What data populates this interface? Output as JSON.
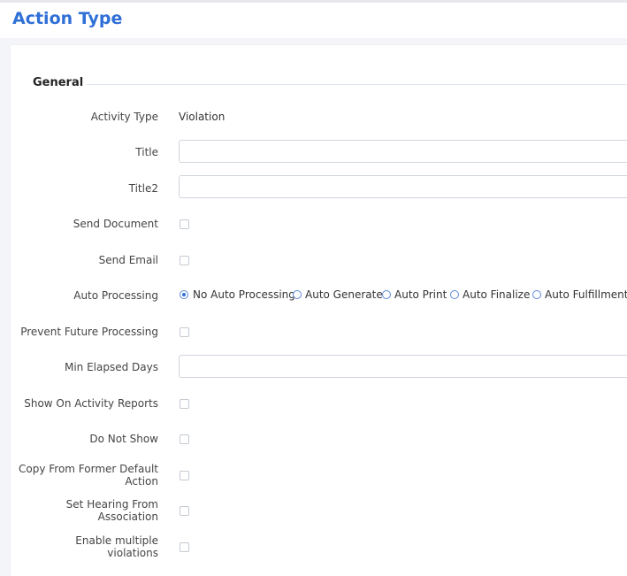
{
  "header": {
    "title": "Action Type"
  },
  "section": {
    "title": "General"
  },
  "fields": {
    "activity_type": {
      "label": "Activity Type",
      "value": "Violation"
    },
    "title": {
      "label": "Title",
      "value": ""
    },
    "title2": {
      "label": "Title2",
      "value": ""
    },
    "send_document": {
      "label": "Send Document",
      "checked": false
    },
    "send_email": {
      "label": "Send Email",
      "checked": false
    },
    "auto_processing": {
      "label": "Auto Processing",
      "options": [
        "No Auto Processing",
        "Auto Generate",
        "Auto Print",
        "Auto Finalize",
        "Auto Fulfillment"
      ],
      "selected": "No Auto Processing"
    },
    "prevent_future_processing": {
      "label": "Prevent Future Processing",
      "checked": false
    },
    "min_elapsed_days": {
      "label": "Min Elapsed Days",
      "value": ""
    },
    "show_on_activity_reports": {
      "label": "Show On Activity Reports",
      "checked": false
    },
    "do_not_show": {
      "label": "Do Not Show",
      "checked": false
    },
    "copy_from_former_default_action": {
      "label_line1": "Copy From Former Default",
      "label_line2": "Action",
      "checked": false
    },
    "set_hearing_from_association": {
      "label_line1": "Set Hearing From",
      "label_line2": "Association",
      "checked": false
    },
    "enable_multiple_violations": {
      "label_line1": "Enable multiple",
      "label_line2": "violations",
      "checked": false
    }
  },
  "colors": {
    "accent": "#2f6fd6",
    "border": "#cfd4dc"
  }
}
